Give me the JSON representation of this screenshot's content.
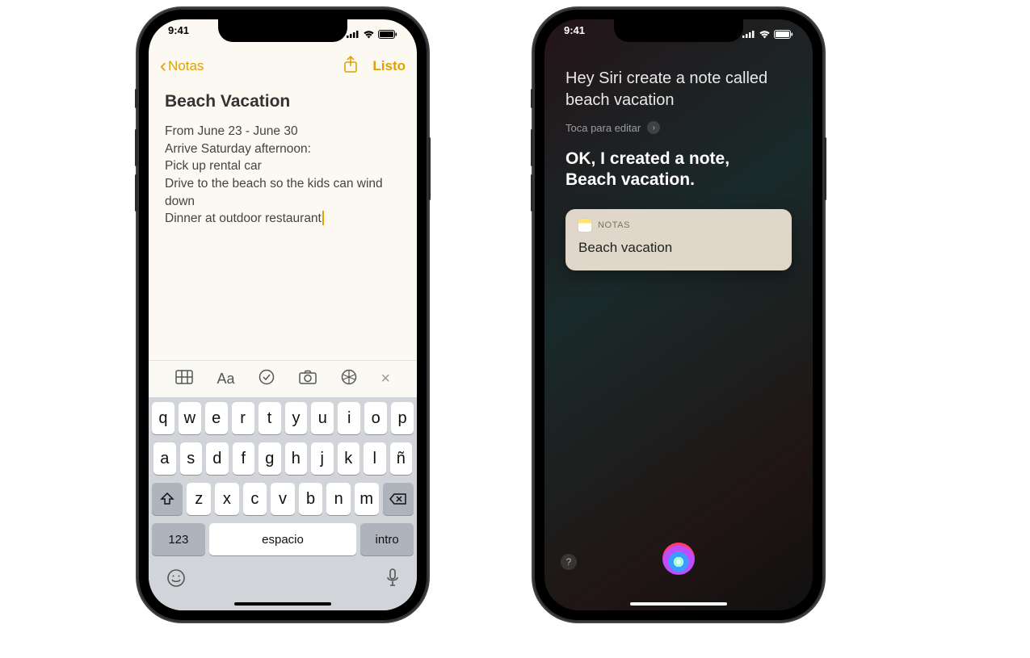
{
  "status": {
    "time": "9:41"
  },
  "notes_app": {
    "back_label": "Notas",
    "done_label": "Listo",
    "title": "Beach Vacation",
    "lines": {
      "l0": "From June 23 - June 30",
      "l1": "Arrive Saturday afternoon:",
      "l2": "Pick up rental car",
      "l3": "Drive to the beach so the kids can wind down",
      "l4": "Dinner at outdoor restaurant"
    },
    "toolbar_icons": {
      "table": "table-icon",
      "text": "Aa",
      "checklist": "checklist-icon",
      "camera": "camera-icon",
      "draw": "draw-icon",
      "close": "×"
    },
    "keyboard": {
      "row1": [
        "q",
        "w",
        "e",
        "r",
        "t",
        "y",
        "u",
        "i",
        "o",
        "p"
      ],
      "row2": [
        "a",
        "s",
        "d",
        "f",
        "g",
        "h",
        "j",
        "k",
        "l",
        "ñ"
      ],
      "row3": [
        "z",
        "x",
        "c",
        "v",
        "b",
        "n",
        "m"
      ],
      "numbers": "123",
      "space": "espacio",
      "return": "intro"
    }
  },
  "siri": {
    "user_request": "Hey Siri create a note called beach vacation",
    "edit_hint": "Toca para editar",
    "response_line1": "OK, I created a note,",
    "response_line2": "Beach vacation.",
    "card_app": "NOTAS",
    "card_title": "Beach vacation",
    "help": "?"
  }
}
